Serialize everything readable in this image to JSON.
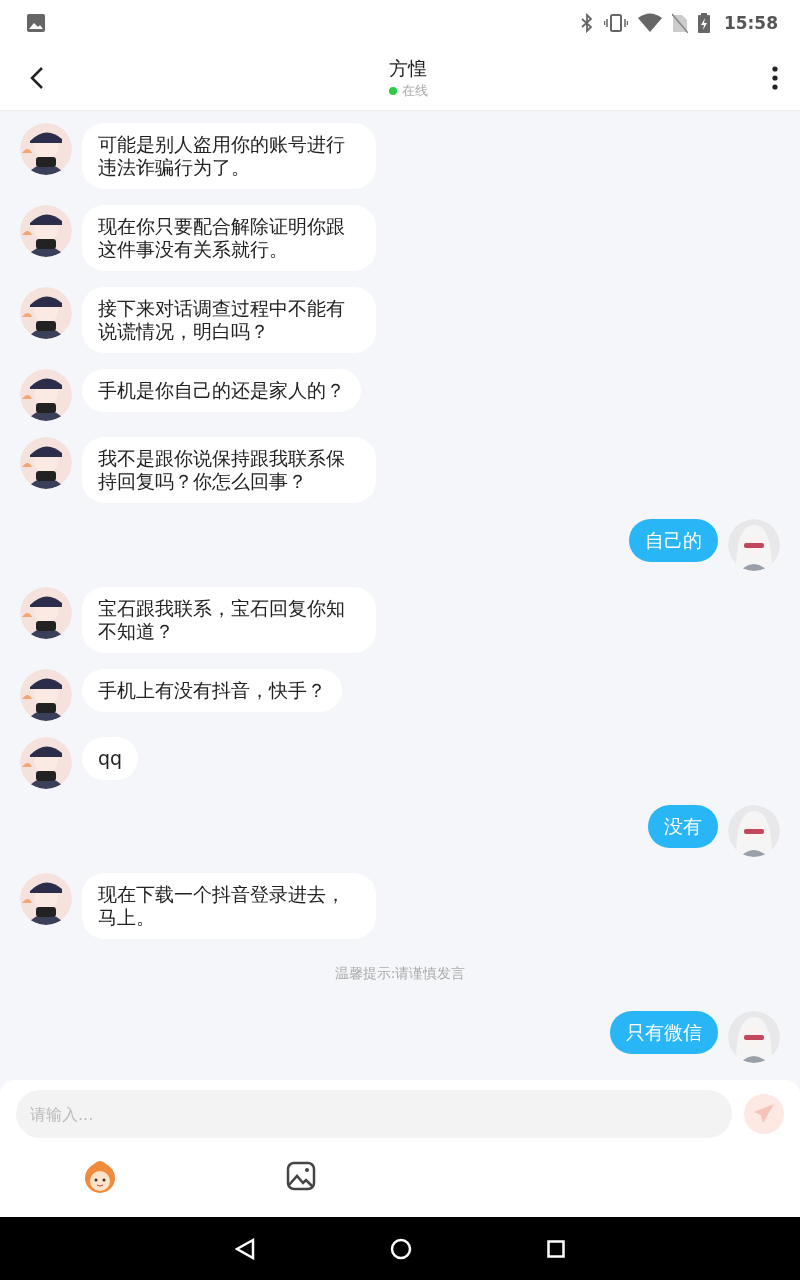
{
  "status_bar": {
    "time": "15:58"
  },
  "header": {
    "title": "方惶",
    "presence": "在线",
    "online": true
  },
  "messages": [
    {
      "kind": "left",
      "text": "可能是别人盗用你的账号进行违法诈骗行为了。"
    },
    {
      "kind": "left",
      "text": "现在你只要配合解除证明你跟这件事没有关系就行。"
    },
    {
      "kind": "left",
      "text": "接下来对话调查过程中不能有说谎情况，明白吗？"
    },
    {
      "kind": "left",
      "text": "手机是你自己的还是家人的？"
    },
    {
      "kind": "left",
      "text": "我不是跟你说保持跟我联系保持回复吗？你怎么回事？"
    },
    {
      "kind": "right",
      "text": "自己的"
    },
    {
      "kind": "left",
      "text": "宝石跟我联系，宝石回复你知不知道？"
    },
    {
      "kind": "left",
      "text": "手机上有没有抖音，快手？"
    },
    {
      "kind": "left",
      "text": "qq"
    },
    {
      "kind": "right",
      "text": "没有"
    },
    {
      "kind": "left",
      "text": "现在下载一个抖音登录进去，马上。"
    },
    {
      "kind": "notice",
      "text": "温馨提示:请谨慎发言"
    },
    {
      "kind": "right",
      "text": "只有微信"
    }
  ],
  "composer": {
    "placeholder": "请输入..."
  }
}
